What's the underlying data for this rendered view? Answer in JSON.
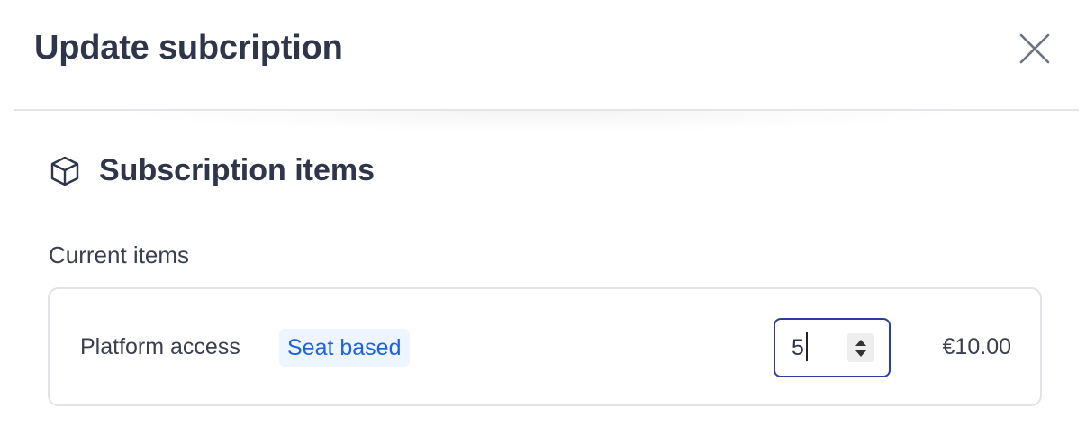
{
  "dialog": {
    "title": "Update subcription",
    "close_icon": "close-icon"
  },
  "section": {
    "icon": "box-icon",
    "title": "Subscription items",
    "current_label": "Current items"
  },
  "item": {
    "name": "Platform access",
    "badge": "Seat based",
    "quantity": "5",
    "price": "€10.00"
  },
  "colors": {
    "title_text": "#30364a",
    "badge_bg": "#eef5ff",
    "badge_text": "#1d63e0",
    "focus_border": "#2d3d9e",
    "card_border": "#e1e3e8"
  }
}
